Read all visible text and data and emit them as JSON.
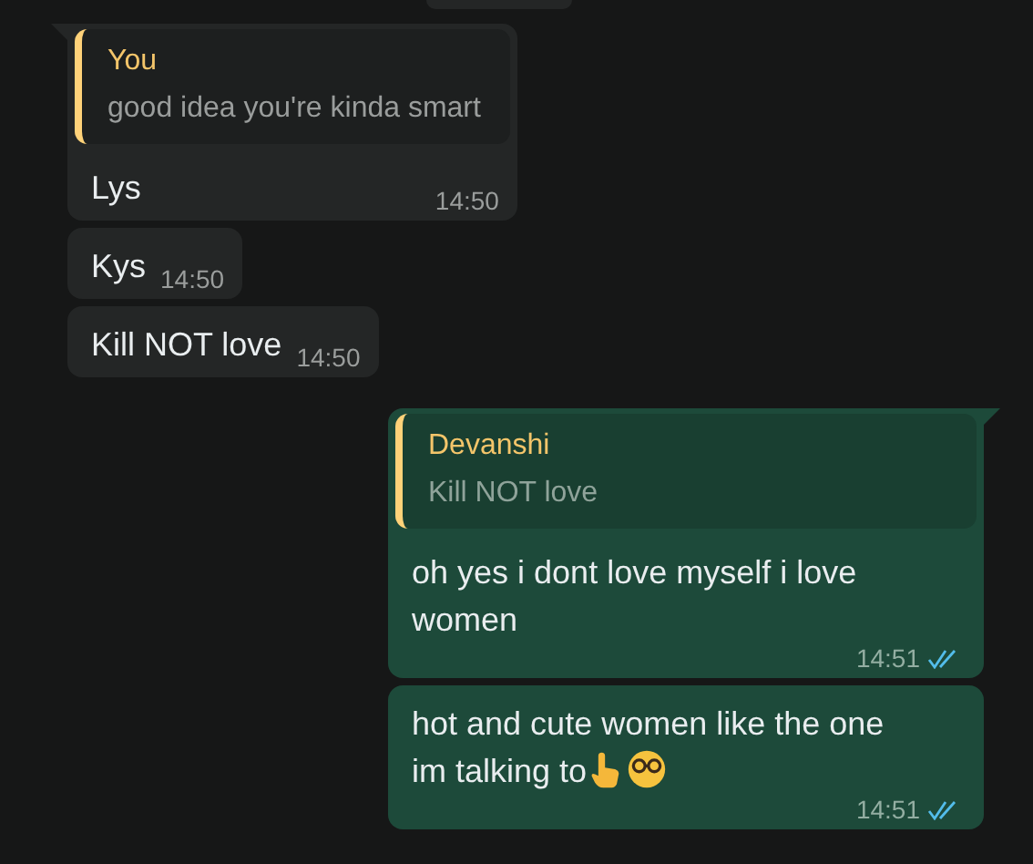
{
  "messages": [
    {
      "kind": "incoming",
      "tail": true,
      "quote": {
        "author": "You",
        "text": "good idea you're kinda smart"
      },
      "text": "Lys",
      "time": "14:50"
    },
    {
      "kind": "incoming",
      "tail": false,
      "text": "Kys",
      "time": "14:50"
    },
    {
      "kind": "incoming",
      "tail": false,
      "text": "Kill NOT love",
      "time": "14:50"
    },
    {
      "kind": "outgoing",
      "tail": true,
      "quote": {
        "author": "Devanshi",
        "text": "Kill NOT love"
      },
      "text": "oh yes i dont love myself i love women",
      "time": "14:51",
      "read": true
    },
    {
      "kind": "outgoing",
      "tail": false,
      "text": "hot and cute women like the one im talking to",
      "emoji": true,
      "time": "14:51",
      "read": true
    }
  ]
}
